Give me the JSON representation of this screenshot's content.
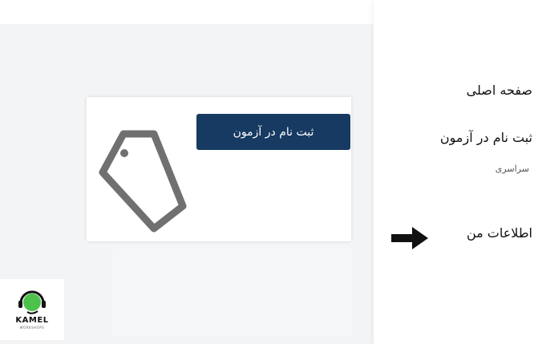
{
  "card": {
    "register_button_label": "ثبت نام در آزمون"
  },
  "sidebar": {
    "home_label": "صفحه اصلی",
    "register_label": "ثبت نام در آزمون",
    "register_sub_label": "سراسری",
    "my_info_label": "اطلاعات من"
  },
  "logo": {
    "word": "KAMEL",
    "sub": "WORKSHOPS"
  },
  "icons": {
    "tag": "tag-icon",
    "arrow": "arrow-right-icon",
    "logo_mark": "headset-icon"
  },
  "colors": {
    "button_bg": "#173a62",
    "button_text": "#ffffff",
    "logo_green": "#4cc24a"
  }
}
